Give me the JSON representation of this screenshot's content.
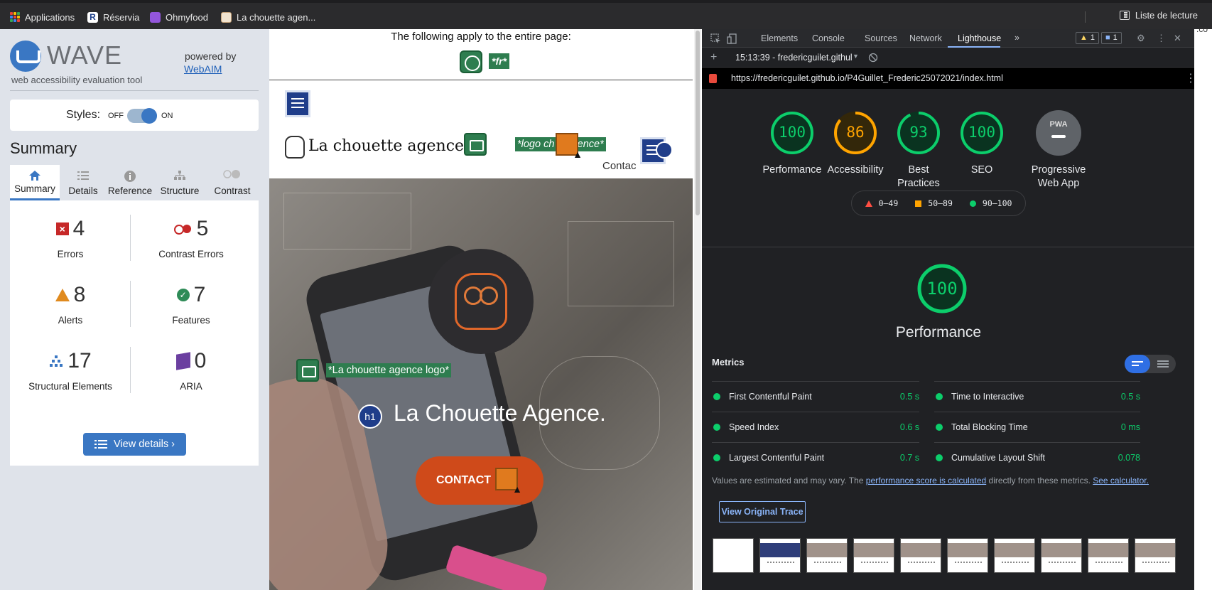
{
  "bookmarks": {
    "items": [
      {
        "label": "Applications",
        "icon": "apps-grid-icon"
      },
      {
        "label": "Réservia",
        "icon": "reservia-icon"
      },
      {
        "label": "Ohmyfood",
        "icon": "ohmyfood-icon"
      },
      {
        "label": "La chouette agen...",
        "icon": "chouette-icon"
      }
    ],
    "reading_list": "Liste de lecture"
  },
  "wave": {
    "title": "WAVE",
    "subtitle": "web accessibility evaluation tool",
    "powered_by": "powered by",
    "webaim": "WebAIM",
    "styles_label": "Styles:",
    "styles_off": "OFF",
    "styles_on": "ON",
    "summary_heading": "Summary",
    "tabs": [
      {
        "label": "Summary",
        "icon": "home-icon"
      },
      {
        "label": "Details",
        "icon": "list-icon"
      },
      {
        "label": "Reference",
        "icon": "info-icon"
      },
      {
        "label": "Structure",
        "icon": "structure-icon"
      },
      {
        "label": "Contrast",
        "icon": "contrast-icon"
      }
    ],
    "stats": {
      "errors": {
        "value": "4",
        "label": "Errors"
      },
      "contrast_errors": {
        "value": "5",
        "label": "Contrast Errors"
      },
      "alerts": {
        "value": "8",
        "label": "Alerts"
      },
      "features": {
        "value": "7",
        "label": "Features"
      },
      "structural": {
        "value": "17",
        "label": "Structural Elements"
      },
      "aria": {
        "value": "0",
        "label": "ARIA"
      }
    },
    "view_details": "View details ›"
  },
  "preview": {
    "apply_text": "The following apply to the entire page:",
    "lang_tag": "*fr*",
    "brand": "La chouette agence",
    "logo_alt_header": "*logo ch   e agence*",
    "contact_peek": "Contac",
    "logo_alt_hero": "*La chouette agence logo*",
    "h1_badge": "h1",
    "hero_title": "La Chouette Agence.",
    "contact_button": "CONTACT"
  },
  "devtools": {
    "tabs": [
      "Elements",
      "Console",
      "Sources",
      "Network",
      "Lighthouse"
    ],
    "active_tab": "Lighthouse",
    "more_tabs": "»",
    "warn_count": "1",
    "msg_count": "1",
    "report_select": "15:13:39 - fredericguilet.githul",
    "add_label": "+",
    "url": "https://fredericguilet.github.io/P4Guillet_Frederic25072021/index.html",
    "scores": [
      {
        "value": "100",
        "label": "Performance",
        "color": "#0cce6b"
      },
      {
        "value": "86",
        "label": "Accessibility",
        "color": "#ffa400"
      },
      {
        "value": "93",
        "label": "Best Practices",
        "color": "#0cce6b"
      },
      {
        "value": "100",
        "label": "SEO",
        "color": "#0cce6b"
      }
    ],
    "pwa": {
      "badge": "PWA",
      "label": "Progressive Web App"
    },
    "legend": [
      {
        "range": "0–49",
        "color": "#ff4e42"
      },
      {
        "range": "50–89",
        "color": "#ffa400"
      },
      {
        "range": "90–100",
        "color": "#0cce6b"
      }
    ],
    "performance": {
      "value": "100",
      "title": "Performance"
    },
    "metrics_heading": "Metrics",
    "metrics_left": [
      {
        "name": "First Contentful Paint",
        "value": "0.5 s"
      },
      {
        "name": "Speed Index",
        "value": "0.6 s"
      },
      {
        "name": "Largest Contentful Paint",
        "value": "0.7 s"
      }
    ],
    "metrics_right": [
      {
        "name": "Time to Interactive",
        "value": "0.5 s"
      },
      {
        "name": "Total Blocking Time",
        "value": "0 ms"
      },
      {
        "name": "Cumulative Layout Shift",
        "value": "0.078"
      }
    ],
    "note_prefix": "Values are estimated and may vary. The ",
    "note_link1": "performance score is calculated",
    "note_middle": " directly from these metrics. ",
    "note_link2": "See calculator.",
    "trace_button": "View Original Trace"
  },
  "edge_text": ".co"
}
